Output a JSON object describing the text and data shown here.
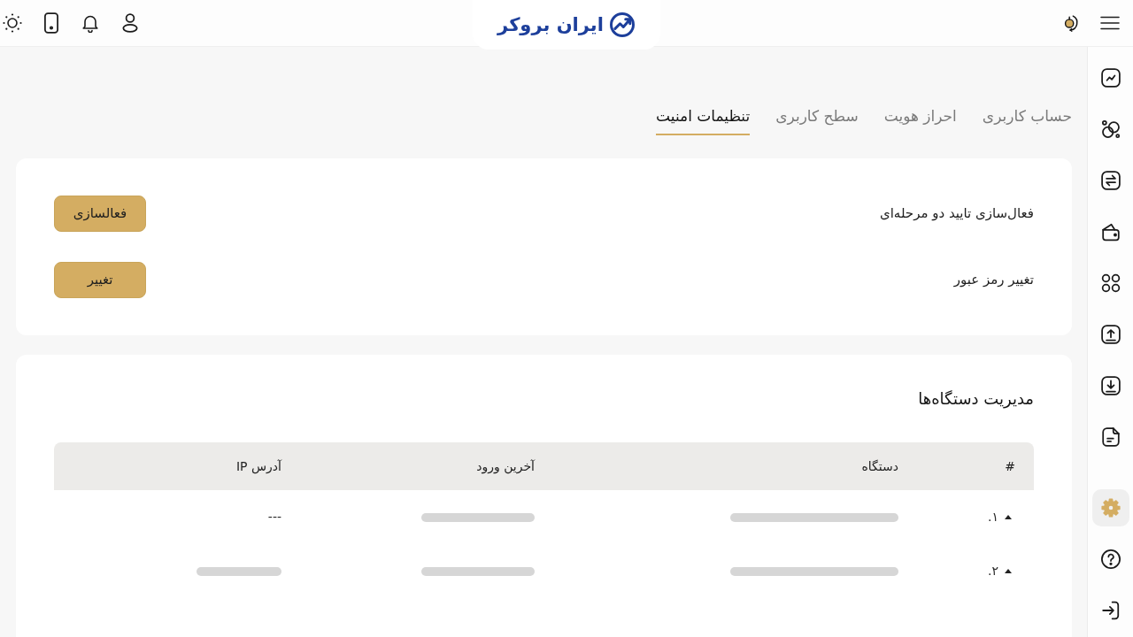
{
  "top_bar": {
    "logo": "ایران بروکر"
  },
  "sidebar": {
    "main_items": [
      {
        "kind": "chart",
        "selected": false
      },
      {
        "kind": "circles",
        "selected": false
      },
      {
        "kind": "swap",
        "selected": false
      },
      {
        "kind": "wallet",
        "selected": false
      },
      {
        "kind": "apps",
        "selected": false
      },
      {
        "kind": "upload",
        "selected": false
      },
      {
        "kind": "download",
        "selected": false
      },
      {
        "kind": "document",
        "selected": false
      }
    ],
    "footer_items": [
      {
        "kind": "settings",
        "selected": true
      },
      {
        "kind": "help",
        "selected": false
      },
      {
        "kind": "enter",
        "selected": false
      }
    ]
  },
  "tabs": [
    {
      "label": "حساب کاربری",
      "selected": false
    },
    {
      "label": "احراز هویت",
      "selected": false
    },
    {
      "label": "سطح کاربری",
      "selected": false
    },
    {
      "label": "تنظیمات امنیت",
      "selected": true
    }
  ],
  "security": {
    "rows": [
      {
        "label": "فعال‌سازی تایید دو مرحله‌ای",
        "button": "فعالسازی"
      },
      {
        "label": "تغییر رمز عبور",
        "button": "تغییر"
      }
    ]
  },
  "devices": {
    "title": "مدیریت دستگاه‌ها",
    "table": {
      "columns": [
        "#",
        "دستگاه",
        "آخرین ورود",
        "آدرس IP"
      ],
      "rows": [
        {
          "cells": [
            {
              "kind": "number",
              "text": "۱."
            },
            {
              "kind": "redacted"
            },
            {
              "kind": "redacted"
            },
            {
              "kind": "text",
              "text": "---"
            }
          ]
        },
        {
          "cells": [
            {
              "kind": "number",
              "text": "۲."
            },
            {
              "kind": "redacted"
            },
            {
              "kind": "redacted"
            },
            {
              "kind": "redacted"
            }
          ]
        }
      ]
    }
  }
}
